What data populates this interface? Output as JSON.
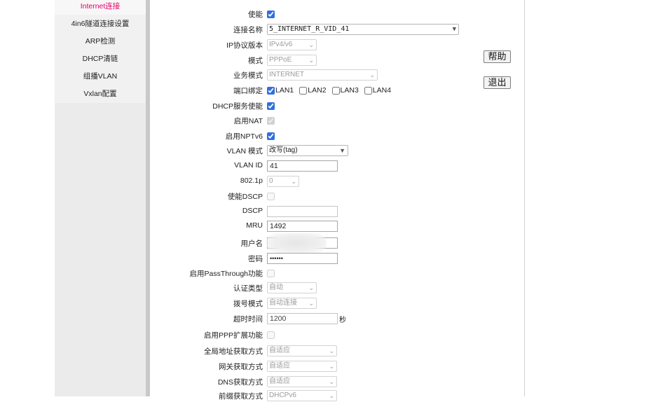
{
  "sidebar": {
    "items": [
      {
        "label": "Internet连接",
        "active": true
      },
      {
        "label": "4in6隧道连接设置",
        "active": false
      },
      {
        "label": "ARP检测",
        "active": false
      },
      {
        "label": "DHCP清链",
        "active": false
      },
      {
        "label": "组播VLAN",
        "active": false
      },
      {
        "label": "Vxlan配置",
        "active": false
      }
    ]
  },
  "form": {
    "enable": {
      "label": "使能",
      "checked": true
    },
    "conn_name": {
      "label": "连接名称",
      "value": "5_INTERNET_R_VID_41"
    },
    "ip_version": {
      "label": "IP协议版本",
      "value": "IPv4/v6"
    },
    "mode": {
      "label": "模式",
      "value": "PPPoE"
    },
    "service_mode": {
      "label": "业务模式",
      "value": "INTERNET"
    },
    "port_bind": {
      "label": "端口绑定",
      "lans": [
        {
          "label": "LAN1",
          "checked": true
        },
        {
          "label": "LAN2",
          "checked": false
        },
        {
          "label": "LAN3",
          "checked": false
        },
        {
          "label": "LAN4",
          "checked": false
        }
      ]
    },
    "dhcp_server": {
      "label": "DHCP服务使能",
      "checked": true
    },
    "nat": {
      "label": "启用NAT",
      "checked": true
    },
    "nptv6": {
      "label": "启用NPTv6",
      "checked": true
    },
    "vlan_mode": {
      "label": "VLAN 模式",
      "value": "改写(tag)"
    },
    "vlan_id": {
      "label": "VLAN ID",
      "value": "41"
    },
    "dot1p": {
      "label": "802.1p",
      "value": "0"
    },
    "dscp_enable": {
      "label": "使能DSCP",
      "checked": false
    },
    "dscp": {
      "label": "DSCP",
      "value": ""
    },
    "mru": {
      "label": "MRU",
      "value": "1492"
    },
    "username": {
      "label": "用户名",
      "value": ""
    },
    "password": {
      "label": "密码",
      "value": "••••••"
    },
    "passthrough": {
      "label": "启用PassThrough功能",
      "checked": false
    },
    "auth_type": {
      "label": "认证类型",
      "value": "自动"
    },
    "dial_mode": {
      "label": "拨号模式",
      "value": "自动连接"
    },
    "timeout": {
      "label": "超时时间",
      "value": "1200",
      "unit": "秒"
    },
    "ppp_ext": {
      "label": "启用PPP扩展功能",
      "checked": false
    },
    "global_addr": {
      "label": "全局地址获取方式",
      "value": "自适应"
    },
    "gateway": {
      "label": "网关获取方式",
      "value": "自适应"
    },
    "dns": {
      "label": "DNS获取方式",
      "value": "自适应"
    },
    "prefix": {
      "label": "前缀获取方式",
      "value": "DHCPv6"
    }
  },
  "buttons": {
    "help": "帮助",
    "exit": "退出"
  },
  "colors": {
    "active_nav": "#e3006b",
    "sidebar_bg": "#f1f1f1",
    "divider": "#c9c9c9"
  }
}
